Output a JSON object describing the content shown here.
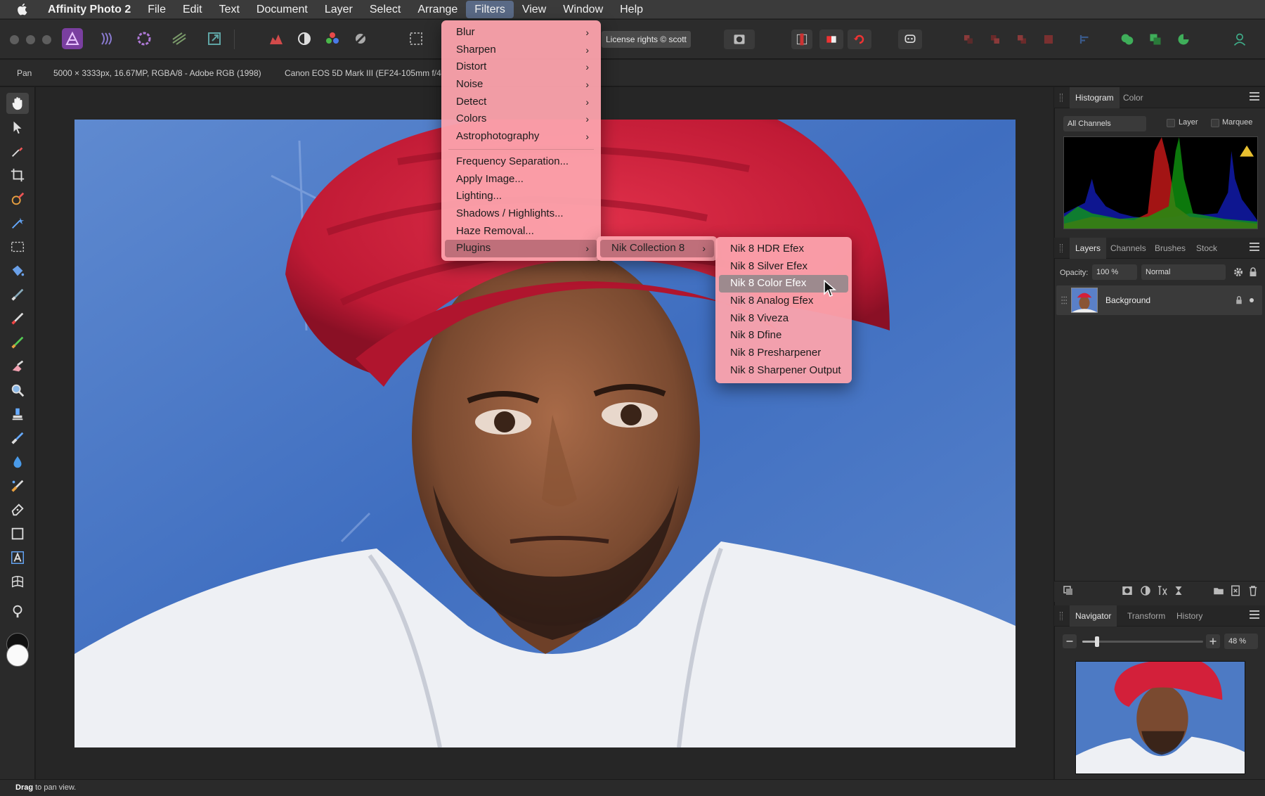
{
  "menubar": {
    "app_name": "Affinity Photo 2",
    "items": [
      "File",
      "Edit",
      "Text",
      "Document",
      "Layer",
      "Select",
      "Arrange",
      "Filters",
      "View",
      "Window",
      "Help"
    ],
    "active": "Filters"
  },
  "toolbar": {
    "license_text": "License rights © scott"
  },
  "contextbar": {
    "tool": "Pan",
    "doc_info": "5000 × 3333px, 16.67MP, RGBA/8 - Adobe RGB (1998)",
    "camera": "Canon EOS 5D Mark III (EF24-105mm f/4"
  },
  "filters_menu": {
    "items": [
      "Blur",
      "Sharpen",
      "Distort",
      "Noise",
      "Detect",
      "Colors",
      "Astrophotography",
      "Frequency Separation...",
      "Apply Image...",
      "Lighting...",
      "Shadows / Highlights...",
      "Haze Removal...",
      "Plugins"
    ],
    "highlighted": "Plugins"
  },
  "plugins_menu": {
    "items": [
      "Nik Collection 8"
    ]
  },
  "nik_menu": {
    "items": [
      "Nik 8 HDR Efex",
      "Nik 8 Silver Efex",
      "Nik 8 Color Efex",
      "Nik 8 Analog Efex",
      "Nik 8 Viveza",
      "Nik 8 Dfine",
      "Nik 8 Presharpener",
      "Nik 8 Sharpener Output"
    ],
    "selected": "Nik 8 Color Efex"
  },
  "histogram_panel": {
    "tabs": [
      "Histogram",
      "Color"
    ],
    "active_tab": "Histogram",
    "channel": "All Channels",
    "layer_label": "Layer",
    "marquee_label": "Marquee"
  },
  "layers_panel": {
    "tabs": [
      "Layers",
      "Channels",
      "Brushes",
      "Stock"
    ],
    "active_tab": "Layers",
    "opacity_label": "Opacity:",
    "opacity_value": "100 %",
    "blend_mode": "Normal",
    "layers": [
      {
        "name": "Background",
        "locked": true
      }
    ]
  },
  "navigator_panel": {
    "tabs": [
      "Navigator",
      "Transform",
      "History"
    ],
    "active_tab": "Navigator",
    "zoom": "48 %",
    "zoom_level": 0.12
  },
  "statusbar": {
    "bold": "Drag",
    "text": " to pan view."
  },
  "colors": {
    "menu_bg": "#fca2ac",
    "accent": "#5a6a86",
    "photo_bg": "#4d7ac4",
    "turban": "#d3203a"
  }
}
